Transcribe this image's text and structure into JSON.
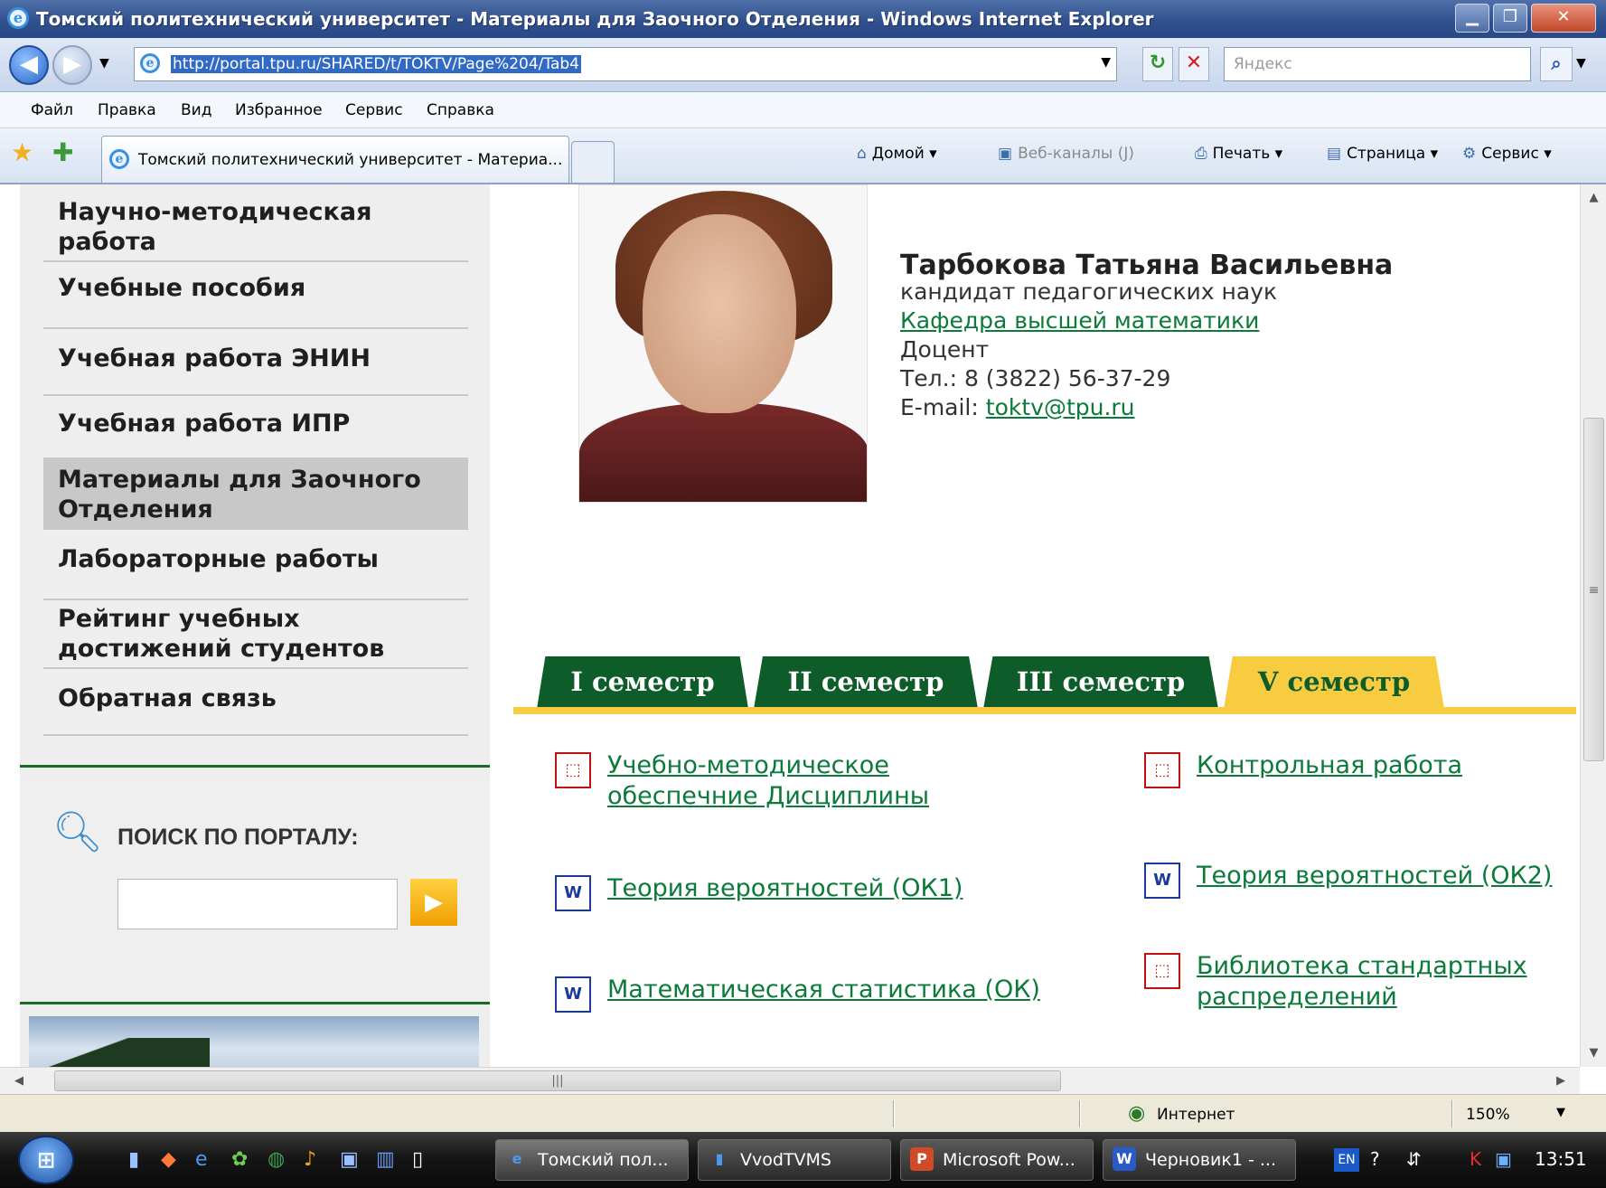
{
  "window": {
    "title": "Томский политехнический университет - Материалы для Заочного Отделения - Windows Internet Explorer",
    "btn_min": "▁",
    "btn_max": "❐",
    "btn_close": "✕"
  },
  "address": {
    "url": "http://portal.tpu.ru/SHARED/t/TOKTV/Page%204/Tab4",
    "search_placeholder": "Яндекс"
  },
  "menu": [
    "Файл",
    "Правка",
    "Вид",
    "Избранное",
    "Сервис",
    "Справка"
  ],
  "tab": {
    "title": "Томский политехнический университет - Материа..."
  },
  "commands": {
    "home": "Домой",
    "feeds": "Веб-каналы (J)",
    "print": "Печать",
    "page": "Страница",
    "tools": "Сервис"
  },
  "sidebar": {
    "items": [
      {
        "label": "Научно-методическая работа"
      },
      {
        "label": "Учебные пособия"
      },
      {
        "label": "Учебная работа ЭНИН"
      },
      {
        "label": "Учебная работа ИПР"
      },
      {
        "label": "Материалы для Заочного Отделения",
        "active": true
      },
      {
        "label": "Лабораторные работы"
      },
      {
        "label": "Рейтинг учебных достижений студентов"
      },
      {
        "label": "Обратная связь"
      }
    ],
    "search_label": "ПОИСК ПО ПОРТАЛУ:"
  },
  "profile": {
    "name": "Тарбокова Татьяна Васильевна",
    "degree": "кандидат  педагогических  наук",
    "department": "Кафедра  высшей  математики",
    "position": "Доцент",
    "phone": "Тел.: 8 (3822)  56-37-29",
    "email_label": "E-mail:",
    "email": "toktv@tpu.ru"
  },
  "semester_tabs": [
    "I семестр",
    "II семестр",
    "III семестр",
    "V семестр"
  ],
  "active_tab": "V семестр",
  "documents": {
    "left": [
      {
        "type": "pdf",
        "title_line1": "Учебно-методическое ",
        "title_line2": "обеспечние  Дисциплины"
      },
      {
        "type": "word",
        "title": "Теория  вероятностей  (ОК1)"
      },
      {
        "type": "word",
        "title": "Математическая  статистика  (ОК)"
      }
    ],
    "right": [
      {
        "type": "pdf",
        "title": "Контрольная  работа"
      },
      {
        "type": "word",
        "title": "Теория  вероятностей  (ОК2)"
      },
      {
        "type": "pdf",
        "title_line1": "Библиотека  стандартных ",
        "title_line2": "распределений"
      }
    ]
  },
  "status": {
    "zone": "Интернет",
    "zoom": "150%"
  },
  "taskbar": {
    "tasks": [
      "Томский пол...",
      "VvodTVMS",
      "Microsoft Pow...",
      "Черновик1 - ..."
    ],
    "lang": "EN",
    "clock": "13:51"
  }
}
